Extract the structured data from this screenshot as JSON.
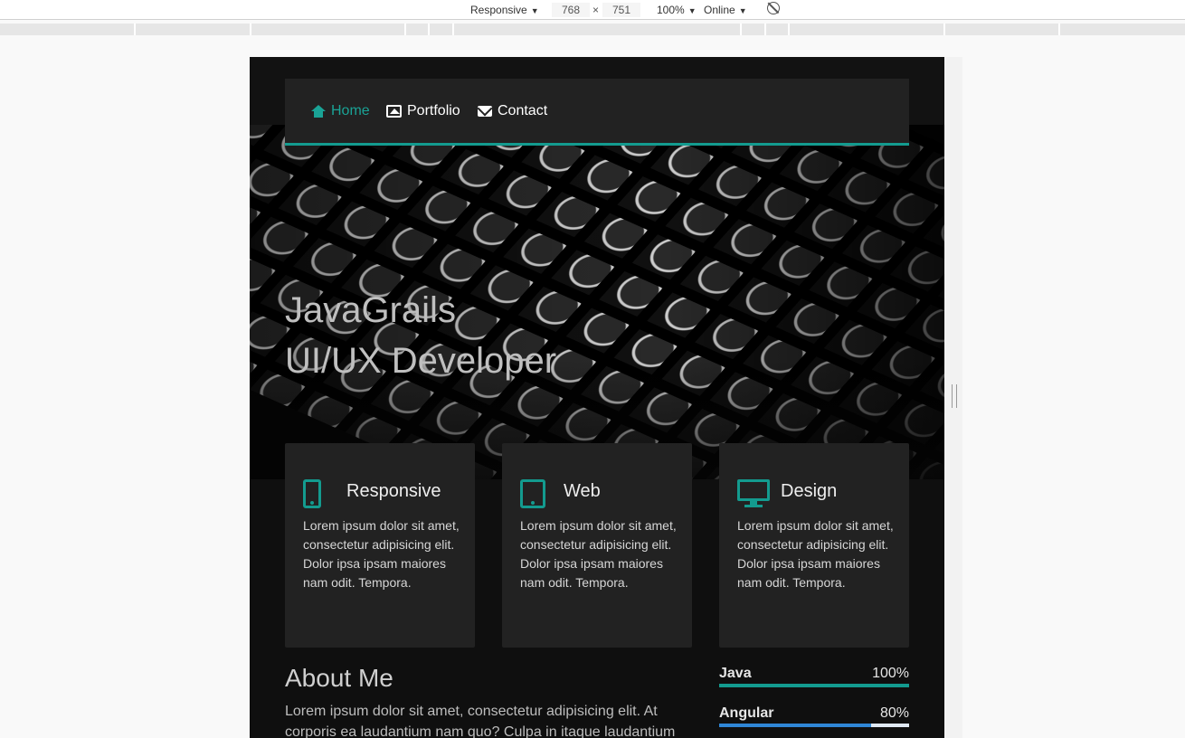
{
  "devtools": {
    "device": "Responsive",
    "width": "768",
    "times": "×",
    "height": "751",
    "zoom": "100%",
    "network": "Online"
  },
  "nav": {
    "items": [
      {
        "label": "Home",
        "icon": "home-icon",
        "active": true
      },
      {
        "label": "Portfolio",
        "icon": "portfolio-icon",
        "active": false
      },
      {
        "label": "Contact",
        "icon": "envelope-icon",
        "active": false
      }
    ]
  },
  "hero": {
    "line1": "JavaGrails",
    "line2": "UI/UX Developer"
  },
  "features": [
    {
      "title": "Responsive",
      "icon": "mobile-icon",
      "text": "Lorem ipsum dolor sit amet, consectetur adipisicing elit. Dolor ipsa ipsam maiores nam odit. Tempora."
    },
    {
      "title": "Web",
      "icon": "tablet-icon",
      "text": "Lorem ipsum dolor sit amet, consectetur adipisicing elit. Dolor ipsa ipsam maiores nam odit. Tempora."
    },
    {
      "title": "Design",
      "icon": "desktop-icon",
      "text": "Lorem ipsum dolor sit amet, consectetur adipisicing elit. Dolor ipsa ipsam maiores nam odit. Tempora."
    }
  ],
  "about": {
    "title": "About Me",
    "text": "Lorem ipsum dolor sit amet, consectetur adipisicing elit. At corporis ea laudantium nam quo? Culpa in itaque laudantium"
  },
  "skills": [
    {
      "name": "Java",
      "percent_label": "100%",
      "level": 1.0,
      "color": "#139b8f"
    },
    {
      "name": "Angular",
      "percent_label": "80%",
      "level": 0.8,
      "color": "#2f86d6"
    }
  ],
  "colors": {
    "accent": "#139b8f",
    "background": "#0f0f0f",
    "card": "#222222"
  }
}
